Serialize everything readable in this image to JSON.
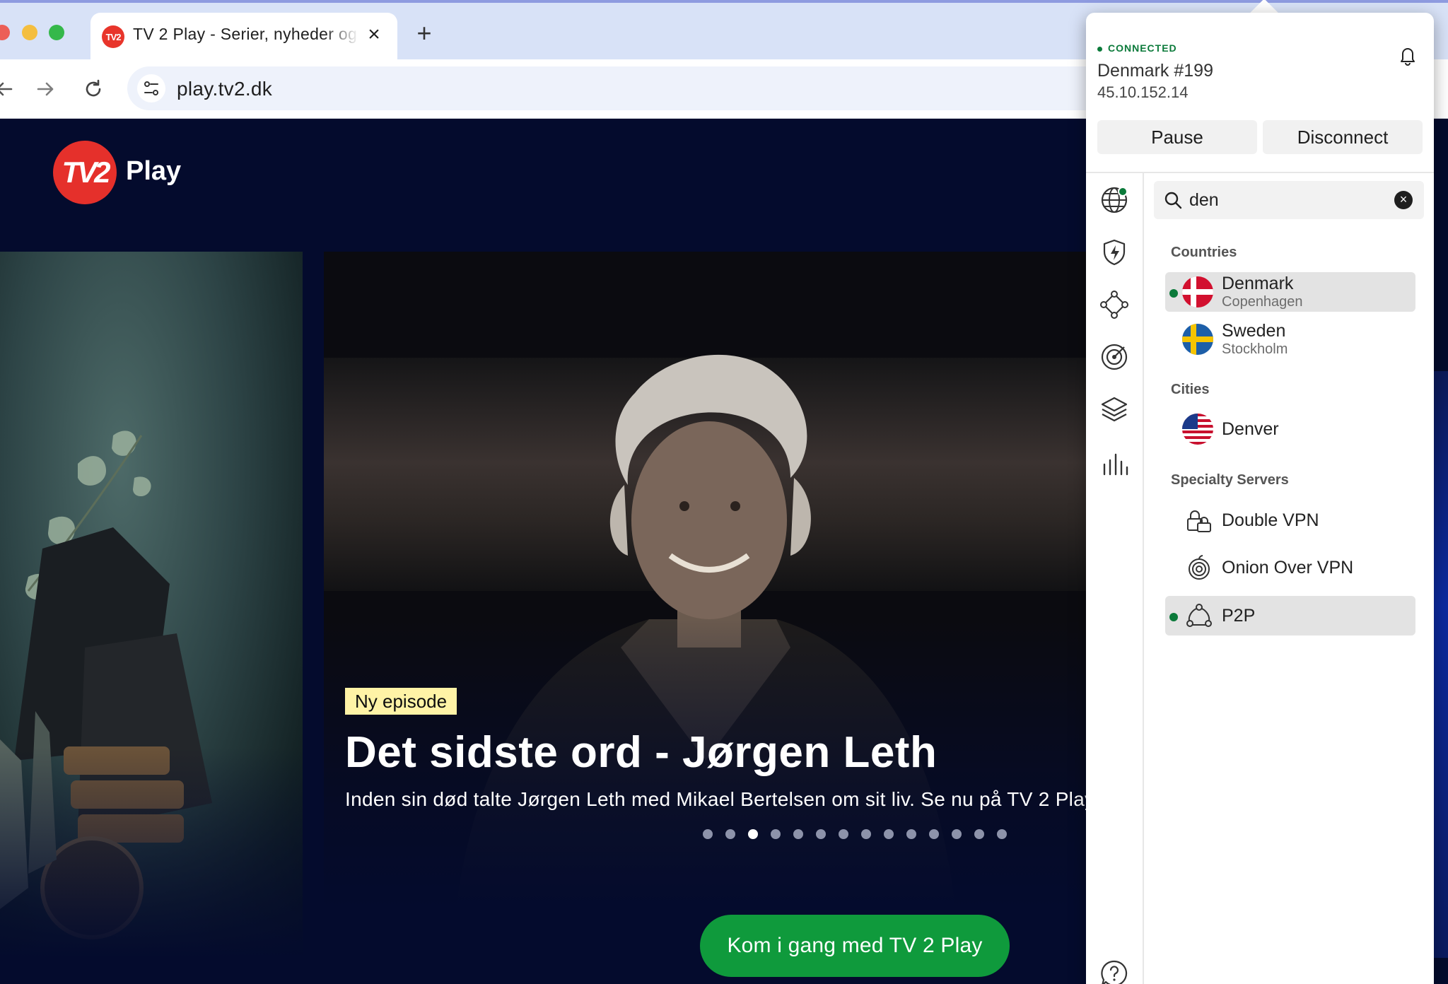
{
  "browser": {
    "tab_title": "TV 2 Play - Serier, nyheder og",
    "tab_favicon_text": "TV2",
    "close_icon": "×",
    "new_tab_icon": "+",
    "url": "play.tv2.dk"
  },
  "site": {
    "logo_text": "TV2",
    "brand_name": "Play",
    "hero": {
      "badge": "Ny episode",
      "title": "Det sidste ord - Jørgen Leth",
      "subtitle": "Inden sin død talte Jørgen Leth med Mikael Bertelsen om sit liv. Se nu på TV 2 Play."
    },
    "carousel": {
      "count": 14,
      "active_index": 2
    },
    "cta_label": "Kom i gang med TV 2 Play",
    "accent": "#e5302b",
    "cta_color": "#0f9a3c"
  },
  "vpn": {
    "status": "CONNECTED",
    "server": "Denmark #199",
    "ip": "45.10.152.14",
    "pause_label": "Pause",
    "disconnect_label": "Disconnect",
    "search_value": "den",
    "sections": {
      "countries": "Countries",
      "cities": "Cities",
      "specialty": "Specialty Servers"
    },
    "countries": [
      {
        "name": "Denmark",
        "sub": "Copenhagen",
        "connected": true
      },
      {
        "name": "Sweden",
        "sub": "Stockholm",
        "connected": false
      }
    ],
    "cities": [
      {
        "name": "Denver",
        "connected": false
      }
    ],
    "specialty": [
      {
        "name": "Double VPN",
        "icon": "double-vpn-icon",
        "connected": false
      },
      {
        "name": "Onion Over VPN",
        "icon": "onion-icon",
        "connected": false
      },
      {
        "name": "P2P",
        "icon": "p2p-icon",
        "connected": true
      }
    ],
    "rail_icons": [
      "globe-icon",
      "threat-protection-icon",
      "meshnet-icon",
      "dark-web-monitor-icon",
      "layers-icon",
      "stats-icon",
      "help-icon"
    ],
    "status_color": "#0b7a3a"
  }
}
